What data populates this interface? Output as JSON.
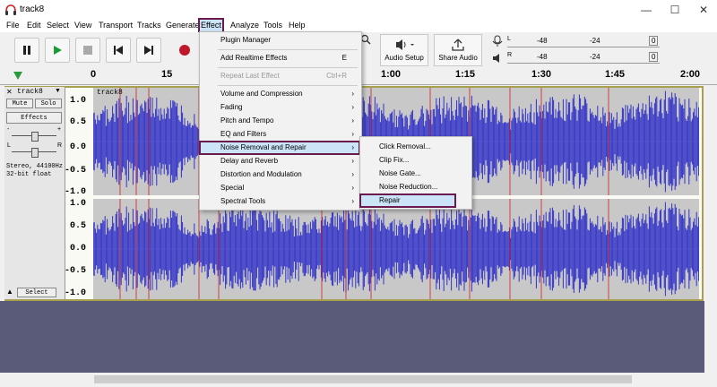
{
  "window": {
    "title": "track8",
    "minimize": "—",
    "maximize": "☐",
    "close": "✕",
    "icon": "headphones-icon"
  },
  "menubar": [
    "File",
    "Edit",
    "Select",
    "View",
    "Transport",
    "Tracks",
    "Generate",
    "Effect",
    "Analyze",
    "Tools",
    "Help"
  ],
  "toolbar": {
    "audio_setup": "Audio Setup",
    "share_audio": "Share Audio",
    "meter_ticks": [
      "-48",
      "-24",
      "0"
    ],
    "meter_labels": [
      "L",
      "R"
    ]
  },
  "ruler": {
    "ticks": [
      "0",
      "15",
      "1:00",
      "1:15",
      "1:30",
      "1:45",
      "2:00"
    ]
  },
  "track": {
    "name": "track8",
    "mute": "Mute",
    "solo": "Solo",
    "effects": "Effects",
    "gain_minus": "-",
    "gain_plus": "+",
    "pan_l": "L",
    "pan_r": "R",
    "info": "Stereo, 44100Hz\n32-bit float",
    "select": "Select",
    "clip_name": "track8",
    "scale": [
      "1.0",
      "0.5",
      "0.0",
      "-0.5",
      "-1.0"
    ]
  },
  "effect_menu": {
    "items": [
      {
        "label": "Plugin Manager",
        "shortcut": "",
        "submenu": false,
        "disabled": false
      },
      {
        "label": "Add Realtime Effects",
        "shortcut": "E",
        "submenu": false,
        "disabled": false
      },
      {
        "label": "Repeat Last Effect",
        "shortcut": "Ctrl+R",
        "submenu": false,
        "disabled": true
      },
      {
        "label": "Volume and Compression",
        "shortcut": "",
        "submenu": true,
        "disabled": false
      },
      {
        "label": "Fading",
        "shortcut": "",
        "submenu": true,
        "disabled": false
      },
      {
        "label": "Pitch and Tempo",
        "shortcut": "",
        "submenu": true,
        "disabled": false
      },
      {
        "label": "EQ and Filters",
        "shortcut": "",
        "submenu": true,
        "disabled": false
      },
      {
        "label": "Noise Removal and Repair",
        "shortcut": "",
        "submenu": true,
        "disabled": false
      },
      {
        "label": "Delay and Reverb",
        "shortcut": "",
        "submenu": true,
        "disabled": false
      },
      {
        "label": "Distortion and Modulation",
        "shortcut": "",
        "submenu": true,
        "disabled": false
      },
      {
        "label": "Special",
        "shortcut": "",
        "submenu": true,
        "disabled": false
      },
      {
        "label": "Spectral Tools",
        "shortcut": "",
        "submenu": true,
        "disabled": false
      }
    ]
  },
  "noise_submenu": {
    "items": [
      "Click Removal...",
      "Clip Fix...",
      "Noise Gate...",
      "Noise Reduction...",
      "Repair"
    ]
  },
  "colors": {
    "waveform": "#3232c8",
    "track_bg": "#c0c0c0",
    "highlight": "#cce4f7",
    "callout_border": "#6a1a4c",
    "lower_area": "#595b78"
  }
}
